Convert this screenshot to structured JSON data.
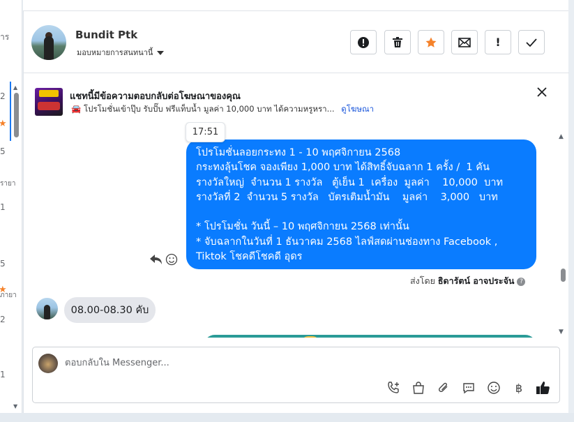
{
  "left_list": {
    "items": [
      "าร",
      "2",
      "5",
      "รายา",
      "1",
      "5",
      "ภายา",
      "2",
      "1"
    ]
  },
  "header": {
    "contact_name": "Bundit Ptk",
    "assign_label": "มอบหมายการสนทนานี้",
    "actions": [
      {
        "name": "spam-button",
        "icon": "exclamation-circle-icon"
      },
      {
        "name": "delete-button",
        "icon": "trash-icon"
      },
      {
        "name": "star-button",
        "icon": "star-icon"
      },
      {
        "name": "mark-unread-button",
        "icon": "envelope-icon"
      },
      {
        "name": "follow-up-button",
        "icon": "exclamation-icon"
      },
      {
        "name": "done-button",
        "icon": "check-icon"
      }
    ],
    "colors": {
      "star": "#f5822a"
    }
  },
  "ad_banner": {
    "title": "แชทนี้มีข้อความตอบกลับต่อโฆษณาของคุณ",
    "subtitle": "🚘 โปรโมชั่นเข้าปุ๊บ รับปั๊บ ฟรีแท็บน้ำ มูลค่า 10,000 บาท ได้ความหรูหรา...",
    "link": "ดูโฆษณา"
  },
  "messages": {
    "time_label": "17:51",
    "outgoing_lines": [
      "โปรโมชั่นลอยกระทง 1 - 10 พฤศจิกายน 2568",
      "กระทงลุ้นโชค จองเพียง 1,000 บาท ได้สิทธิ์จับฉลาก 1 ครั้ง /  1 คัน",
      "รางวัลใหญ่  จำนวน 1 รางวัล   ตู้เย็น 1  เครื่อง  มูลค่า    10,000  บาท",
      "รางวัลที่ 2  จำนวน 5 รางวัล   บัตรเติมน้ำมัน    มูลค่า    3,000   บาท",
      "",
      "* โปรโมชั่น วันนี้ – 10 พฤศจิกายน 2568 เท่านั้น",
      "* จับฉลากในวันที่ 1 ธันวาคม 2568 ไลฟ์สดผ่านช่องทาง Facebook ,",
      "Tiktok โชคดีโชคดี อุดร"
    ],
    "sent_by_prefix": "ส่งโดย",
    "sent_by_name": "ธิดารัตน์ อาจประจัน",
    "incoming_text": "08.00-08.30 คับ",
    "colors": {
      "outgoing_bubble": "#0a7cff",
      "incoming_bubble": "#e4e6eb"
    }
  },
  "composer": {
    "placeholder": "ตอบกลับใน Messenger...",
    "tools": [
      "phone-add-icon",
      "shopping-bag-icon",
      "paperclip-icon",
      "chat-bubble-icon",
      "emoji-icon",
      "baht-icon",
      "thumbs-up-icon"
    ],
    "baht_symbol": "฿"
  }
}
